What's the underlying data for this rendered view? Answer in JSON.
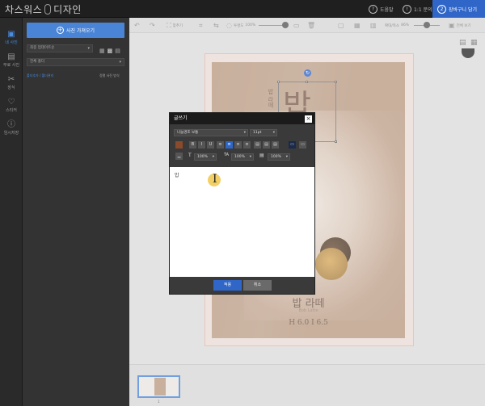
{
  "app": {
    "brand_left": "차스워스",
    "brand_right": "디자인"
  },
  "topbar": {
    "help_label": "도움말",
    "share_label": "1:1 문의",
    "cart_label": "장바구니 담기",
    "cart_step": "2",
    "help_icon": "?",
    "share_icon": "!"
  },
  "leftnav": {
    "items": [
      {
        "label": "내 사진",
        "icon": "photo-icon"
      },
      {
        "label": "무료 사진",
        "icon": "gallery-icon"
      },
      {
        "label": "장식",
        "icon": "decor-icon"
      },
      {
        "label": "스티커",
        "icon": "heart-icon"
      },
      {
        "label": "임시저장",
        "icon": "info-icon"
      }
    ]
  },
  "panel": {
    "upload_label": "사진 가져오기",
    "sort_select": "최종 업데이트순",
    "filter_select": "전체 폴더",
    "folder_link": "폴더추가 / 폴더관리",
    "sort_link": "정렬 사진 방식"
  },
  "toolbar": {
    "undo": "↶",
    "redo": "↷",
    "fit_label": "맞추기",
    "opacity_label": "투명도",
    "opacity_value": "100%",
    "zoom_label": "확대/축소",
    "zoom_value": "86%",
    "preview_label": "전체 보기"
  },
  "poster": {
    "big_char": "밥",
    "vertical_text": "밥 라떼",
    "title": "밥 라떼",
    "subtitle": "Bob Latte",
    "price": "H 6.0   I 6.5"
  },
  "modal": {
    "title": "글쓰기",
    "close": "×",
    "font_select": "나눔명조 보통",
    "size_select": "11pt",
    "bold": "B",
    "italic": "I",
    "underline": "U",
    "letter_spacing_value": "100%",
    "line_height_value": "100%",
    "scale_value": "100%",
    "text": "밥",
    "ok_label": "적용",
    "cancel_label": "취소"
  },
  "filmstrip": {
    "page_number": "1"
  },
  "colors": {
    "accent": "#2f66c8",
    "poster_bg": "#b99a82",
    "cursor_highlight": "#f1c84b"
  }
}
